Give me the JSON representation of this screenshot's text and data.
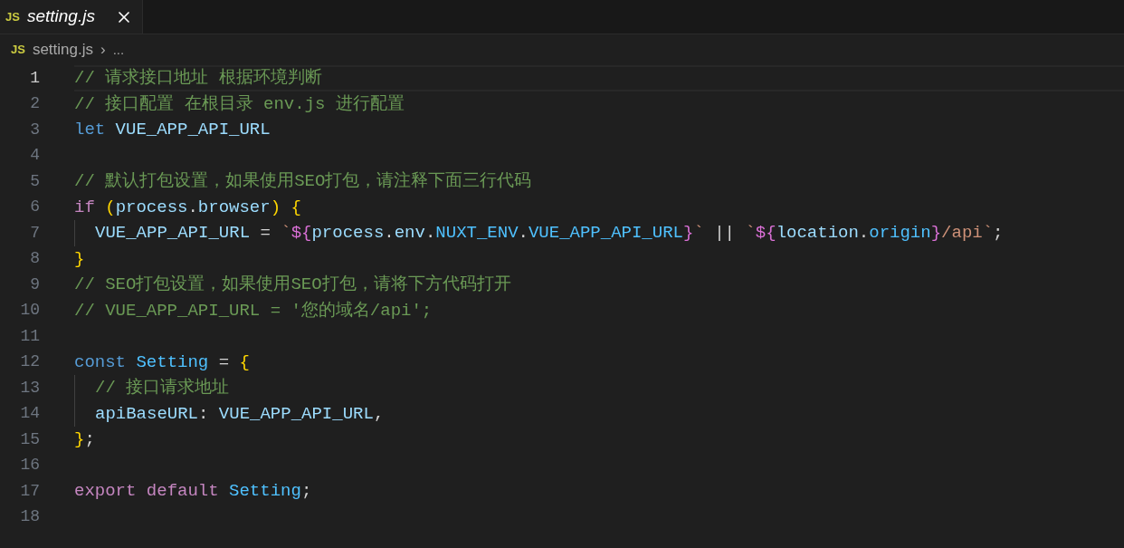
{
  "tabs": [
    {
      "icon_text": "JS",
      "label": "setting.js",
      "selected": true,
      "preview": true
    }
  ],
  "breadcrumb": {
    "icon_text": "JS",
    "file": "setting.js",
    "separator": "›",
    "rest": "..."
  },
  "lines": [
    {
      "number": "1",
      "current": true,
      "indented": false,
      "tokens": [
        {
          "text": "// 请求接口地址 根据环境判断",
          "kind": "comment"
        }
      ]
    },
    {
      "number": "2",
      "current": false,
      "indented": false,
      "tokens": [
        {
          "text": "// 接口配置 在根目录 env.js 进行配置",
          "kind": "comment"
        }
      ]
    },
    {
      "number": "3",
      "current": false,
      "indented": false,
      "tokens": [
        {
          "text": "let ",
          "kind": "keyword"
        },
        {
          "text": "VUE_APP_API_URL",
          "kind": "variable"
        }
      ]
    },
    {
      "number": "4",
      "current": false,
      "indented": false
    },
    {
      "number": "5",
      "current": false,
      "indented": false,
      "tokens": [
        {
          "text": "// 默认打包设置，如果使用SEO打包，请注释下面三行代码",
          "kind": "comment"
        }
      ]
    },
    {
      "number": "6",
      "current": false,
      "indented": false,
      "tokens": [
        {
          "text": "if ",
          "kind": "control"
        },
        {
          "text": "(",
          "kind": "bracket1"
        },
        {
          "text": "process",
          "kind": "variable"
        },
        {
          "text": ".",
          "kind": "plain"
        },
        {
          "text": "browser",
          "kind": "variable"
        },
        {
          "text": ")",
          "kind": "bracket1"
        },
        {
          "text": " {",
          "kind": "bracket1"
        }
      ]
    },
    {
      "number": "7",
      "current": false,
      "indented": true,
      "tokens": [
        {
          "text": "VUE_APP_API_URL",
          "kind": "variable"
        },
        {
          "text": " = ",
          "kind": "plain"
        },
        {
          "text": "`",
          "kind": "string"
        },
        {
          "text": "${",
          "kind": "bracket2"
        },
        {
          "text": "process",
          "kind": "variable"
        },
        {
          "text": ".",
          "kind": "plain"
        },
        {
          "text": "env",
          "kind": "variable"
        },
        {
          "text": ".",
          "kind": "plain"
        },
        {
          "text": "NUXT_ENV",
          "kind": "constant"
        },
        {
          "text": ".",
          "kind": "plain"
        },
        {
          "text": "VUE_APP_API_URL",
          "kind": "constant"
        },
        {
          "text": "}",
          "kind": "bracket2"
        },
        {
          "text": "`",
          "kind": "string"
        },
        {
          "text": " || ",
          "kind": "plain"
        },
        {
          "text": "`",
          "kind": "string"
        },
        {
          "text": "${",
          "kind": "bracket2"
        },
        {
          "text": "location",
          "kind": "variable"
        },
        {
          "text": ".",
          "kind": "plain"
        },
        {
          "text": "origin",
          "kind": "constant"
        },
        {
          "text": "}",
          "kind": "bracket2"
        },
        {
          "text": "/api`",
          "kind": "string"
        },
        {
          "text": ";",
          "kind": "plain"
        }
      ]
    },
    {
      "number": "8",
      "current": false,
      "indented": false,
      "tokens": [
        {
          "text": "}",
          "kind": "bracket1"
        }
      ]
    },
    {
      "number": "9",
      "current": false,
      "indented": false,
      "tokens": [
        {
          "text": "// SEO打包设置，如果使用SEO打包，请将下方代码打开",
          "kind": "comment"
        }
      ]
    },
    {
      "number": "10",
      "current": false,
      "indented": false,
      "tokens": [
        {
          "text": "// VUE_APP_API_URL = '您的域名/api';",
          "kind": "comment"
        }
      ]
    },
    {
      "number": "11",
      "current": false,
      "indented": false
    },
    {
      "number": "12",
      "current": false,
      "indented": false,
      "tokens": [
        {
          "text": "const ",
          "kind": "keyword"
        },
        {
          "text": "Setting",
          "kind": "constant"
        },
        {
          "text": " = ",
          "kind": "plain"
        },
        {
          "text": "{",
          "kind": "bracket1"
        }
      ]
    },
    {
      "number": "13",
      "current": false,
      "indented": true,
      "tokens": [
        {
          "text": "// 接口请求地址",
          "kind": "comment"
        }
      ]
    },
    {
      "number": "14",
      "current": false,
      "indented": true,
      "tokens": [
        {
          "text": "apiBaseURL",
          "kind": "variable"
        },
        {
          "text": ": ",
          "kind": "plain"
        },
        {
          "text": "VUE_APP_API_URL",
          "kind": "variable"
        },
        {
          "text": ",",
          "kind": "plain"
        }
      ]
    },
    {
      "number": "15",
      "current": false,
      "indented": false,
      "tokens": [
        {
          "text": "}",
          "kind": "bracket1"
        },
        {
          "text": ";",
          "kind": "plain"
        }
      ]
    },
    {
      "number": "16",
      "current": false,
      "indented": false
    },
    {
      "number": "17",
      "current": false,
      "indented": false,
      "tokens": [
        {
          "text": "export ",
          "kind": "control"
        },
        {
          "text": "default ",
          "kind": "control"
        },
        {
          "text": "Setting",
          "kind": "constant"
        },
        {
          "text": ";",
          "kind": "plain"
        }
      ]
    },
    {
      "number": "18",
      "current": false,
      "indented": false
    }
  ]
}
